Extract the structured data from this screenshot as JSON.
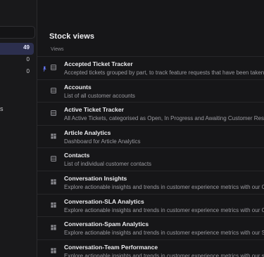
{
  "sidebar": {
    "counts": [
      "49",
      "0",
      "0"
    ],
    "partial_label": "s"
  },
  "main": {
    "title": "Stock views",
    "section_label": "Views",
    "rows": [
      {
        "title": "Accepted Ticket Tracker",
        "desc": "Accepted tickets grouped by part, to track feature requests that have been taken",
        "icon": "table-icon",
        "pinned": true
      },
      {
        "title": "Accounts",
        "desc": "List of all customer accounts",
        "icon": "table-icon",
        "pinned": false
      },
      {
        "title": "Active Ticket Tracker",
        "desc": "All Active Tickets, categorised as Open, In Progress and Awaiting Customer Resp",
        "icon": "table-icon",
        "pinned": false
      },
      {
        "title": "Article Analytics",
        "desc": "Dashboard for Article Analytics",
        "icon": "dashboard-icon",
        "pinned": false
      },
      {
        "title": "Contacts",
        "desc": "List of individual customer contacts",
        "icon": "table-icon",
        "pinned": false
      },
      {
        "title": "Conversation Insights",
        "desc": "Explore actionable insights and trends in customer experience metrics with our C",
        "icon": "dashboard-icon",
        "pinned": false
      },
      {
        "title": "Conversation-SLA Analytics",
        "desc": "Explore actionable insights and trends in customer experience metrics with our Co",
        "icon": "dashboard-icon",
        "pinned": false
      },
      {
        "title": "Conversation-Spam Analytics",
        "desc": "Explore actionable insights and trends in customer experience metrics with our Sp",
        "icon": "dashboard-icon",
        "pinned": false
      },
      {
        "title": "Conversation-Team Performance",
        "desc": "Explore actionable insights and trends in customer experience metrics with our su",
        "icon": "dashboard-icon",
        "pinned": false
      }
    ]
  },
  "colors": {
    "background": "#161618",
    "active_item": "#2c2f4e",
    "pin": "#6b7cff"
  }
}
